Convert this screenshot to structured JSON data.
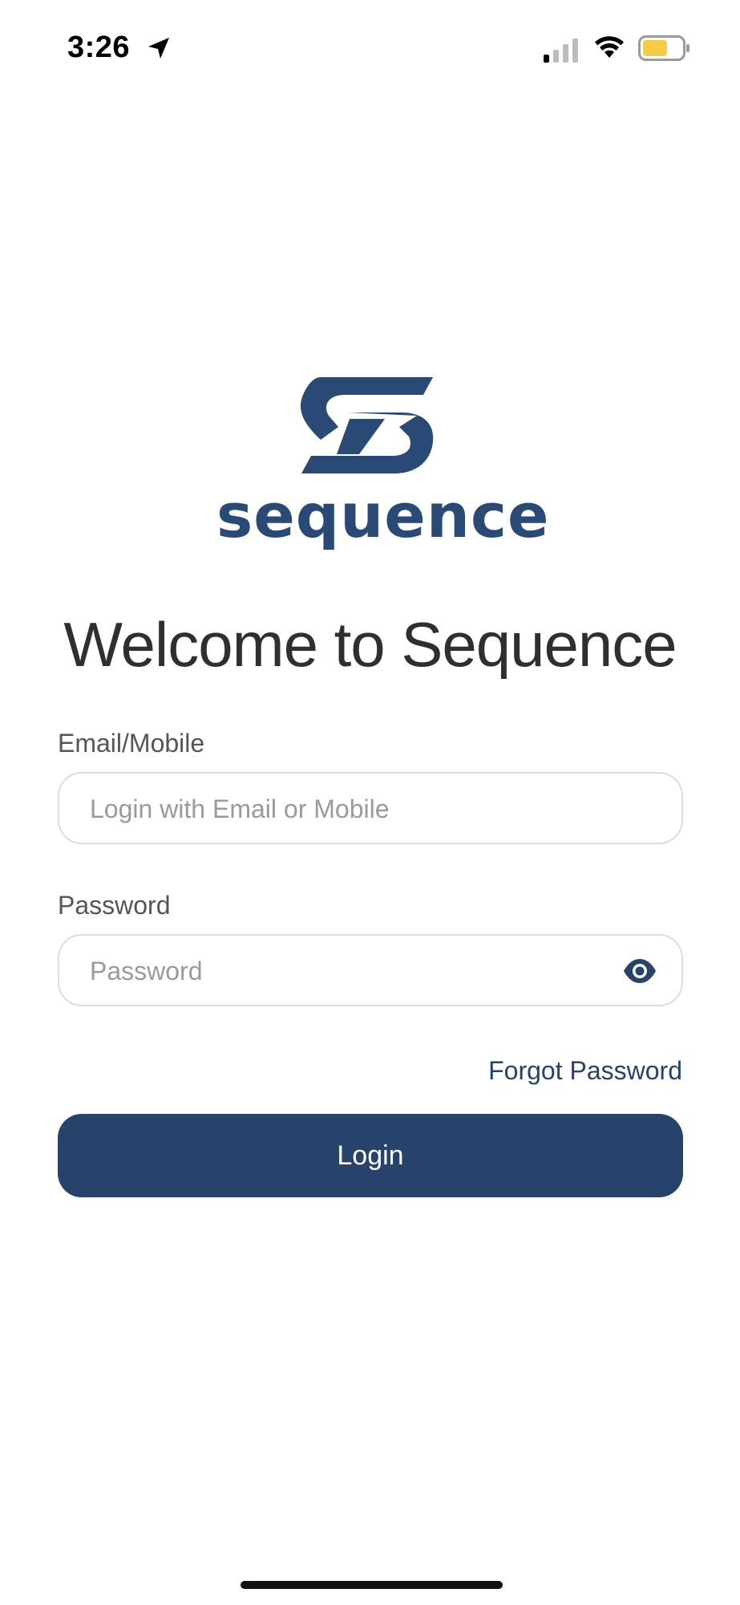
{
  "status_bar": {
    "time": "3:26",
    "icons": [
      "location-arrow-icon",
      "cellular-signal-icon",
      "wifi-icon",
      "battery-icon"
    ],
    "battery_color": "#f6cb46"
  },
  "logo": {
    "wordmark": "sequence",
    "brand_color": "#2a4a76"
  },
  "title": "Welcome to Sequence",
  "form": {
    "email_label": "Email/Mobile",
    "email_placeholder": "Login with Email or Mobile",
    "email_value": "",
    "password_label": "Password",
    "password_placeholder": "Password",
    "password_value": "",
    "password_toggle_icon": "eye-icon",
    "forgot_password": "Forgot Password",
    "login_button": "Login"
  },
  "colors": {
    "accent": "#27436b",
    "text": "#2f2f2f",
    "border": "#dddddd"
  }
}
